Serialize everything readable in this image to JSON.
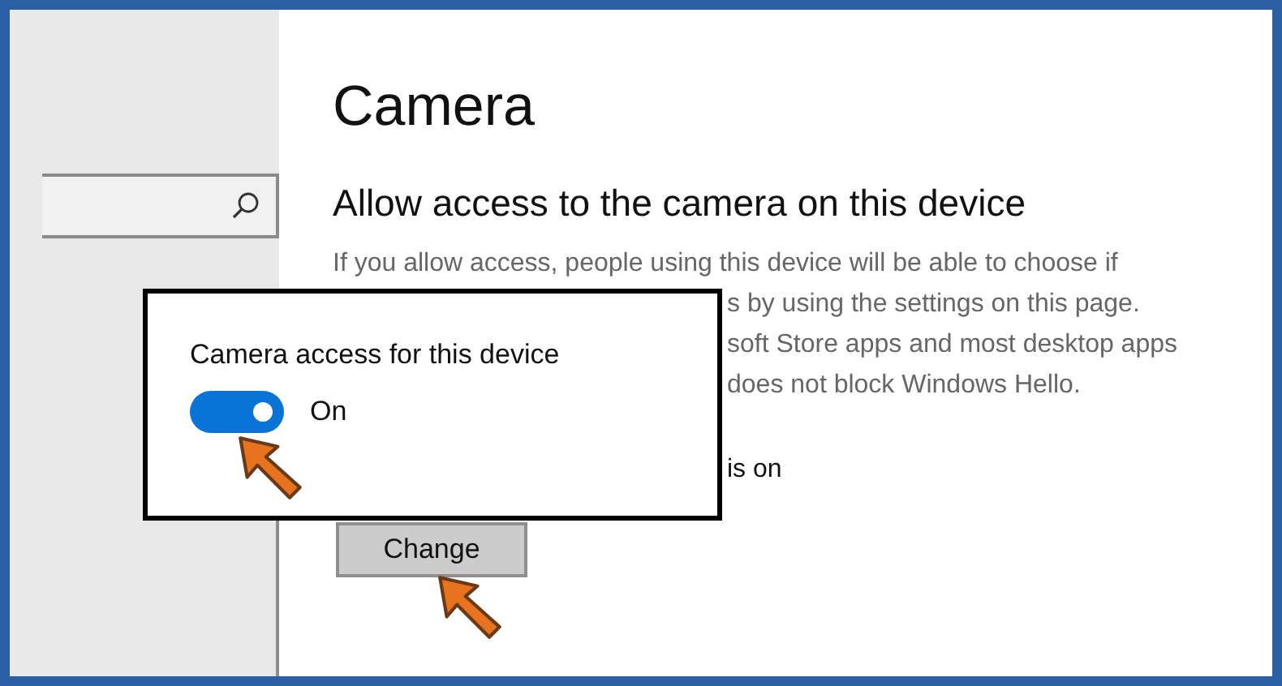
{
  "title": "Camera",
  "heading": "Allow access to the camera on this device",
  "description_lines": [
    "If you allow access, people using this device will be able to choose if",
    "s by using the settings on this page.",
    "soft Store apps and most desktop apps",
    "does not block Windows Hello."
  ],
  "status_text": "is on",
  "change_button": "Change",
  "popup": {
    "label": "Camera access for this device",
    "toggle": {
      "on": true,
      "state_text": "On"
    }
  }
}
